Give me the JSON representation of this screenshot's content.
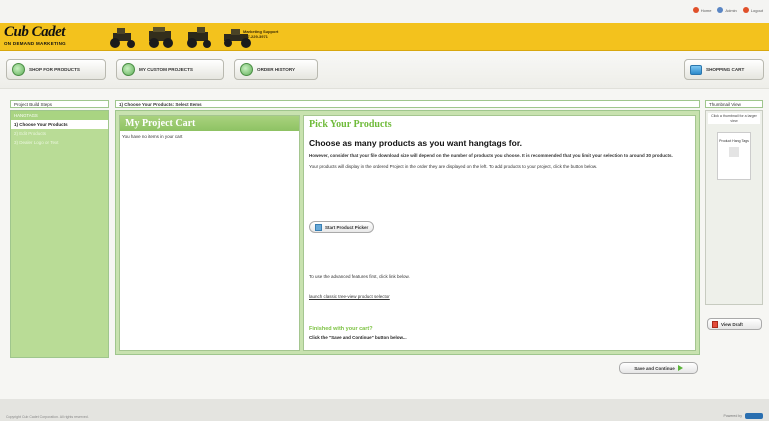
{
  "util": {
    "links": [
      {
        "label": "Home",
        "color": "#e0502a",
        "icon": "home-icon"
      },
      {
        "label": "Admin",
        "color": "#5a86c4",
        "icon": "admin-icon"
      },
      {
        "label": "Logout",
        "color": "#e0502a",
        "icon": "logout-icon"
      }
    ]
  },
  "header": {
    "logo": "Cub Cadet",
    "logo_sub": "ON DEMAND MARKETING",
    "support_title": "Marketing Support",
    "support_phone": "877-229-3971",
    "brand_color": "#f3c21d"
  },
  "nav": {
    "shop": "SHOP FOR PRODUCTS",
    "custom": "MY CUSTOM PROJECTS",
    "orders": "ORDER HISTORY",
    "cart": "SHOPPING CART"
  },
  "sidebar": {
    "title": "Project Build Steps",
    "group": "HANGTAGS",
    "items": [
      {
        "label": "1) Choose Your Products",
        "active": true
      },
      {
        "label": "2) Edit Products",
        "active": false
      },
      {
        "label": "3) Dealer Logo or Text",
        "active": false
      }
    ]
  },
  "main": {
    "title": "1) Choose Your Products: Select Items",
    "cart_title": "My Project Cart",
    "cart_empty": "You have no items in your cart",
    "pick_title": "Pick Your Products",
    "subtitle": "Choose as many products as you want hangtags for.",
    "note": "However, consider that your file download size will depend on the number of products you choose. It is recommended that you limit your selection to around 30 products.",
    "info": "Your products will display in the ordered Project in the order they are displayed on the left. To add products to your project, click the button below.",
    "start_button": "Start Product Picker",
    "advanced_text": "To use the advanced features first, click link below.",
    "advanced_link": "launch classic tree-view product selector",
    "finished_title": "Finished with your cart?",
    "finished_sub": "Click the \"Save and Continue\" button below...",
    "save_button": "Save and Continue"
  },
  "thumbnail": {
    "title": "Thumbnail View",
    "hint": "Click a thumbnail for a larger view",
    "card_label": "Product Hang Tags",
    "view_button": "View Draft"
  },
  "footer": {
    "left": "Copyright Cub Cadet Corporation. All rights reserved.",
    "right": "Powered by"
  }
}
